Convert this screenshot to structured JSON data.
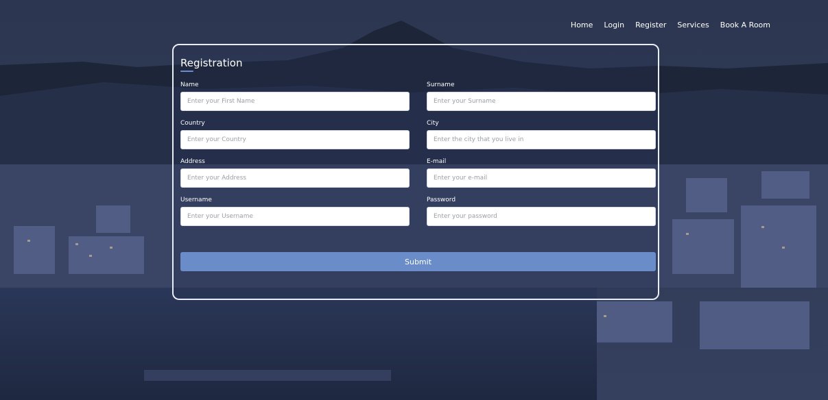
{
  "nav": {
    "items": [
      {
        "label": "Home"
      },
      {
        "label": "Login"
      },
      {
        "label": "Register"
      },
      {
        "label": "Services"
      },
      {
        "label": "Book A Room"
      }
    ]
  },
  "form": {
    "title": "Registration",
    "fields": {
      "name": {
        "label": "Name",
        "placeholder": "Enter your First Name",
        "value": ""
      },
      "surname": {
        "label": "Surname",
        "placeholder": "Enter your Surname",
        "value": ""
      },
      "country": {
        "label": "Country",
        "placeholder": "Enter your Country",
        "value": ""
      },
      "city": {
        "label": "City",
        "placeholder": "Enter the city that you live in",
        "value": ""
      },
      "address": {
        "label": "Address",
        "placeholder": "Enter your Address",
        "value": ""
      },
      "email": {
        "label": "E-mail",
        "placeholder": "Enter your e-mail",
        "value": ""
      },
      "username": {
        "label": "Username",
        "placeholder": "Enter your Username",
        "value": ""
      },
      "password": {
        "label": "Password",
        "placeholder": "Enter your password",
        "value": ""
      }
    },
    "submit_label": "Submit"
  },
  "colors": {
    "accent": "#6a8cc9",
    "card_border": "#e9edf4",
    "background": "#2a3552"
  }
}
